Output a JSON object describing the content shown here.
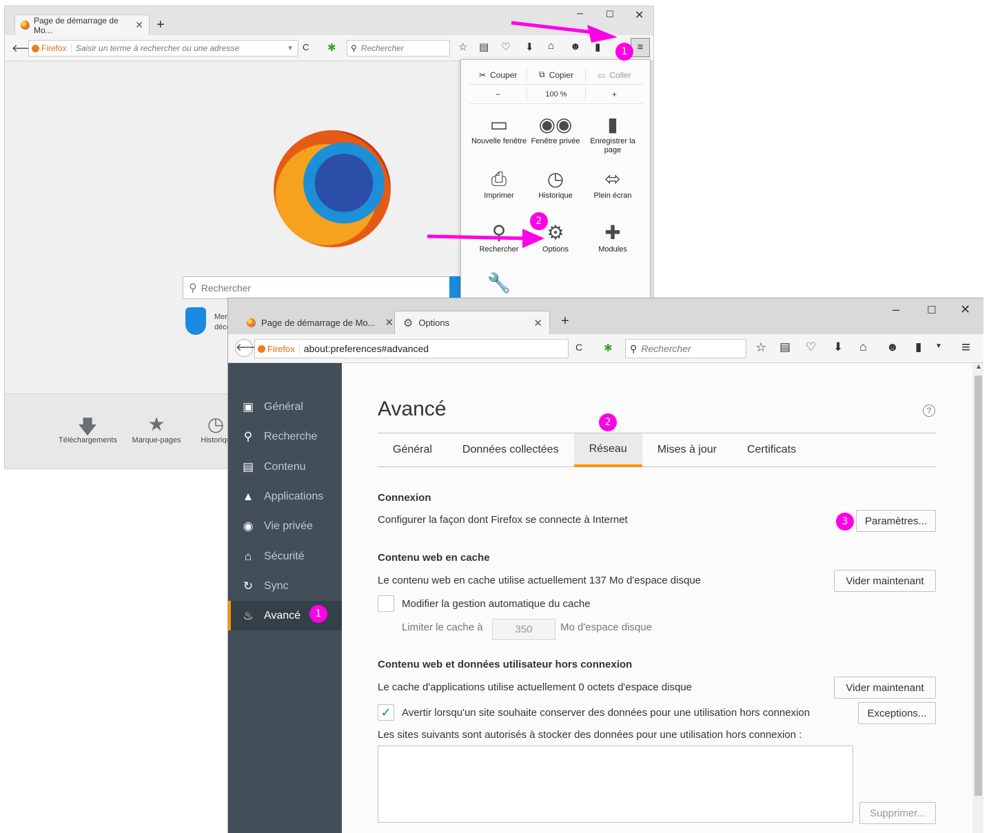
{
  "back": {
    "tab_title": "Page de démarrage de Mo...",
    "brand": "Firefox",
    "url_placeholder": "Saisir un terme à rechercher ou une adresse",
    "search_placeholder": "Rechercher",
    "page_search_placeholder": "Rechercher",
    "snippet_text_1": "Merci",
    "snippet_text_2": "décou",
    "bottom": {
      "downloads": "Téléchargements",
      "bookmarks": "Marque-pages",
      "history": "Historiqu"
    },
    "menu": {
      "cut": "Couper",
      "copy": "Copier",
      "paste": "Coller",
      "zoom_out": "−",
      "zoom": "100 %",
      "zoom_in": "+",
      "new_window": "Nouvelle fenêtre",
      "private_window": "Fenêtre privée",
      "save_page": "Enregistrer la page",
      "print": "Imprimer",
      "history": "Historique",
      "fullscreen": "Plein écran",
      "find": "Rechercher",
      "options": "Options",
      "addons": "Modules"
    }
  },
  "front": {
    "tabs": [
      {
        "title": "Page de démarrage de Mo..."
      },
      {
        "title": "Options"
      }
    ],
    "brand": "Firefox",
    "url": "about:preferences#advanced",
    "search_placeholder": "Rechercher",
    "sidebar": [
      {
        "label": "Général",
        "icon": "general-icon"
      },
      {
        "label": "Recherche",
        "icon": "search-icon"
      },
      {
        "label": "Contenu",
        "icon": "content-icon"
      },
      {
        "label": "Applications",
        "icon": "applications-icon"
      },
      {
        "label": "Vie privée",
        "icon": "privacy-mask-icon"
      },
      {
        "label": "Sécurité",
        "icon": "security-icon"
      },
      {
        "label": "Sync",
        "icon": "sync-icon"
      },
      {
        "label": "Avancé",
        "icon": "advanced-icon"
      }
    ],
    "page_title": "Avancé",
    "pref_tabs": [
      "Général",
      "Données collectées",
      "Réseau",
      "Mises à jour",
      "Certificats"
    ],
    "selected_tab": "Réseau",
    "connection": {
      "heading": "Connexion",
      "description": "Configurer la façon dont Firefox se connecte à Internet",
      "button": "Paramètres..."
    },
    "cache": {
      "heading": "Contenu web en cache",
      "description": "Le contenu web en cache utilise actuellement 137 Mo d'espace disque",
      "button": "Vider maintenant",
      "override_label": "Modifier la gestion automatique du cache",
      "override_checked": false,
      "limit_label": "Limiter le cache à",
      "limit_value": "350",
      "limit_unit": "Mo d'espace disque"
    },
    "offline": {
      "heading": "Contenu web et données utilisateur hors connexion",
      "description": "Le cache d'applications utilise actuellement 0 octets d'espace disque",
      "button": "Vider maintenant",
      "warn_label": "Avertir lorsqu'un site souhaite conserver des données pour une utilisation hors connexion",
      "warn_checked": true,
      "exceptions_button": "Exceptions...",
      "sites_label": "Les sites suivants sont autorisés à stocker des données pour une utilisation hors connexion :",
      "remove_button": "Supprimer..."
    }
  },
  "annotations": {
    "back_step_1": "1",
    "back_step_2": "2",
    "front_step_1": "1",
    "front_step_2": "2",
    "front_step_3": "3",
    "color": "#ff00e6"
  }
}
